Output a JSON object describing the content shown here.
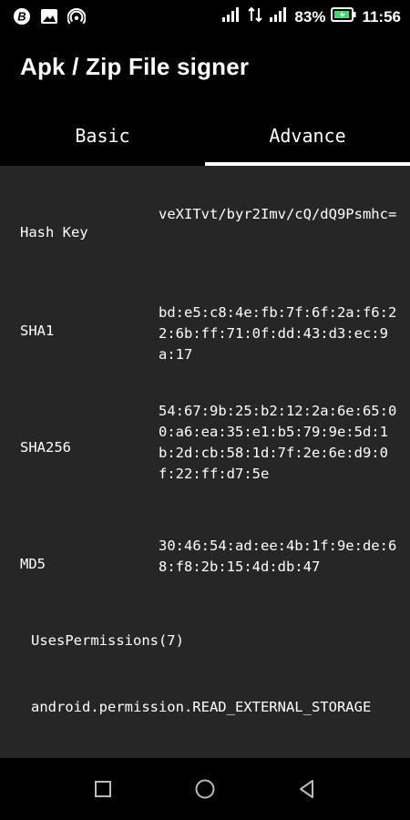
{
  "status_bar": {
    "left_icons": [
      "b-circle-icon",
      "image-icon",
      "hotspot-icon"
    ],
    "signal_icons": [
      "signal-icon",
      "data-transfer-icon",
      "signal-icon"
    ],
    "battery_percent": "83%",
    "time": "11:56"
  },
  "app_bar": {
    "title": "Apk / Zip File signer"
  },
  "tabs": [
    {
      "label": "Basic",
      "active": false
    },
    {
      "label": "Advance",
      "active": true
    }
  ],
  "details": {
    "hash_key": {
      "label": "Hash Key",
      "value": "veXITvt/byr2Imv/cQ/dQ9Psmhc="
    },
    "sha1": {
      "label": "SHA1",
      "value": "bd:e5:c8:4e:fb:7f:6f:2a:f6:22:6b:ff:71:0f:dd:43:d3:ec:9a:17"
    },
    "sha256": {
      "label": "SHA256",
      "value": "54:67:9b:25:b2:12:2a:6e:65:00:a6:ea:35:e1:b5:79:9e:5d:1b:2d:cb:58:1d:7f:2e:6e:d9:0f:22:ff:d7:5e"
    },
    "md5": {
      "label": "MD5",
      "value": "30:46:54:ad:ee:4b:1f:9e:de:68:f8:2b:15:4d:db:47"
    }
  },
  "permissions": {
    "title": "UsesPermissions(7)",
    "items": [
      "android.permission.READ_EXTERNAL_STORAGE"
    ]
  },
  "nav_bar": {
    "buttons": [
      "recents-square-icon",
      "home-circle-icon",
      "back-triangle-icon"
    ]
  }
}
